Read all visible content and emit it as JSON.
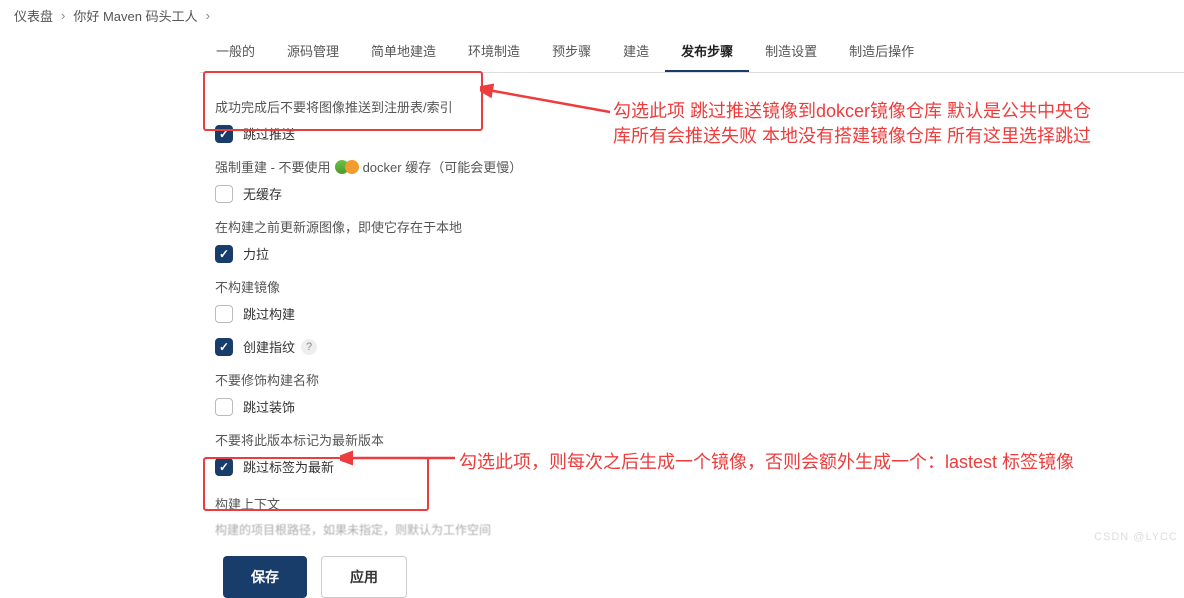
{
  "breadcrumb": {
    "item1": "仪表盘",
    "item2": "你好 Maven 码头工人"
  },
  "tabs": {
    "general": "一般的",
    "scm": "源码管理",
    "basic_build": "简单地建造",
    "env": "环境制造",
    "pre_step": "预步骤",
    "build": "建造",
    "post_step": "发布步骤",
    "make_setting": "制造设置",
    "post_make": "制造后操作"
  },
  "section1": {
    "title": "成功完成后不要将图像推送到注册表/索引",
    "opt1": "跳过推送"
  },
  "section2": {
    "title_a": "强制重建 - 不要使用",
    "title_b": "docker 缓存（可能会更慢）",
    "opt1": "无缓存"
  },
  "section3": {
    "title": "在构建之前更新源图像，即使它存在于本地",
    "opt1": "力拉"
  },
  "section4": {
    "title": "不构建镜像",
    "opt1": "跳过构建"
  },
  "section5": {
    "opt1": "创建指纹"
  },
  "section6": {
    "title": "不要修饰构建名称",
    "opt1": "跳过装饰"
  },
  "section7": {
    "title": "不要将此版本标记为最新版本",
    "opt1": "跳过标签为最新"
  },
  "section8": {
    "title": "构建上下文",
    "sub": "构建的项目根路径，如果未指定，则默认为工作空间"
  },
  "buttons": {
    "save": "保存",
    "apply": "应用"
  },
  "annotations": {
    "anno1_line1": "勾选此项 跳过推送镜像到dokcer镜像仓库 默认是公共中央仓",
    "anno1_line2": "库所有会推送失败 本地没有搭建镜像仓库 所有这里选择跳过",
    "anno2": "勾选此项，则每次之后生成一个镜像，否则会额外生成一个：lastest 标签镜像"
  },
  "watermark": "CSDN @LYCC"
}
